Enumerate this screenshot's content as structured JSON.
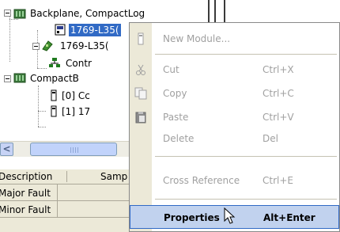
{
  "tree": {
    "nodes": [
      {
        "label": "Backplane, CompactLog"
      },
      {
        "label": "1769-L35("
      },
      {
        "label": "1769-L35("
      },
      {
        "label": "Contr"
      },
      {
        "label": "CompactB"
      },
      {
        "label": "[0] Cc"
      },
      {
        "label": "[1] 17"
      }
    ]
  },
  "scrollbar": {
    "left_arrow": "<"
  },
  "properties_grid": {
    "headers": [
      "Description",
      "Samp"
    ],
    "rows": [
      {
        "label": "Major Fault"
      },
      {
        "label": "Minor Fault"
      }
    ]
  },
  "context_menu": {
    "items": [
      {
        "label": "New Module...",
        "shortcut": "",
        "enabled": false
      },
      {
        "label": "Cut",
        "shortcut": "Ctrl+X",
        "enabled": false
      },
      {
        "label": "Copy",
        "shortcut": "Ctrl+C",
        "enabled": false
      },
      {
        "label": "Paste",
        "shortcut": "Ctrl+V",
        "enabled": false
      },
      {
        "label": "Delete",
        "shortcut": "Del",
        "enabled": false
      },
      {
        "label": "Cross Reference",
        "shortcut": "Ctrl+E",
        "enabled": false
      },
      {
        "label": "Properties",
        "shortcut": "Alt+Enter",
        "enabled": true,
        "highlighted": true
      }
    ]
  },
  "colors": {
    "selection": "#316ac5",
    "menu_highlight": "#c1d2ee",
    "menu_gutter": "#ece9d8",
    "disabled_text": "#a0a0a0"
  }
}
